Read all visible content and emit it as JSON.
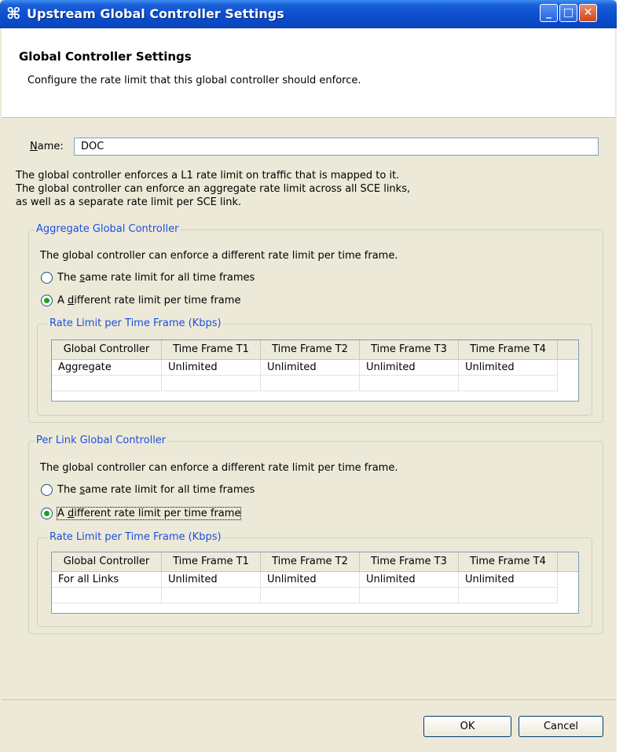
{
  "window": {
    "title": "Upstream Global Controller Settings",
    "icon": "gear-icon",
    "controls": {
      "minimize": "_",
      "maximize": "□",
      "close": "✕"
    }
  },
  "header": {
    "title": "Global Controller Settings",
    "description": "Configure the rate limit that this global controller should enforce."
  },
  "name_field": {
    "label_prefix": "N",
    "label_rest": "ame:",
    "value": "DOC"
  },
  "info_text": {
    "line1": "The global controller enforces a L1 rate limit on traffic that is mapped to it.",
    "line2": "The global controller can enforce an aggregate rate limit across all SCE links,",
    "line3": "as well as a separate rate limit per SCE link."
  },
  "aggregate": {
    "legend": "Aggregate Global Controller",
    "text": "The global controller can enforce a different rate limit per time frame.",
    "radio_same": {
      "pre": "The ",
      "key": "s",
      "post": "ame rate limit for all time frames",
      "selected": false
    },
    "radio_diff": {
      "pre": "A ",
      "key": "d",
      "post": "ifferent rate limit per time frame",
      "selected": true
    },
    "table_legend": "Rate Limit per Time Frame (Kbps)",
    "columns": [
      "Global Controller",
      "Time Frame T1",
      "Time Frame T2",
      "Time Frame T3",
      "Time Frame T4"
    ],
    "rows": [
      [
        "Aggregate",
        "Unlimited",
        "Unlimited",
        "Unlimited",
        "Unlimited"
      ]
    ]
  },
  "perlink": {
    "legend": "Per Link Global Controller",
    "text": "The global controller can enforce a different rate limit per time frame.",
    "radio_same": {
      "pre": "The ",
      "key": "s",
      "post": "ame rate limit for all time frames",
      "selected": false
    },
    "radio_diff": {
      "pre": "A ",
      "key": "d",
      "post": "ifferent rate limit per time frame",
      "selected": true
    },
    "table_legend": "Rate Limit per Time Frame (Kbps)",
    "columns": [
      "Global Controller",
      "Time Frame T1",
      "Time Frame T2",
      "Time Frame T3",
      "Time Frame T4"
    ],
    "rows": [
      [
        "For all Links",
        "Unlimited",
        "Unlimited",
        "Unlimited",
        "Unlimited"
      ]
    ]
  },
  "buttons": {
    "ok": "OK",
    "cancel": "Cancel"
  }
}
